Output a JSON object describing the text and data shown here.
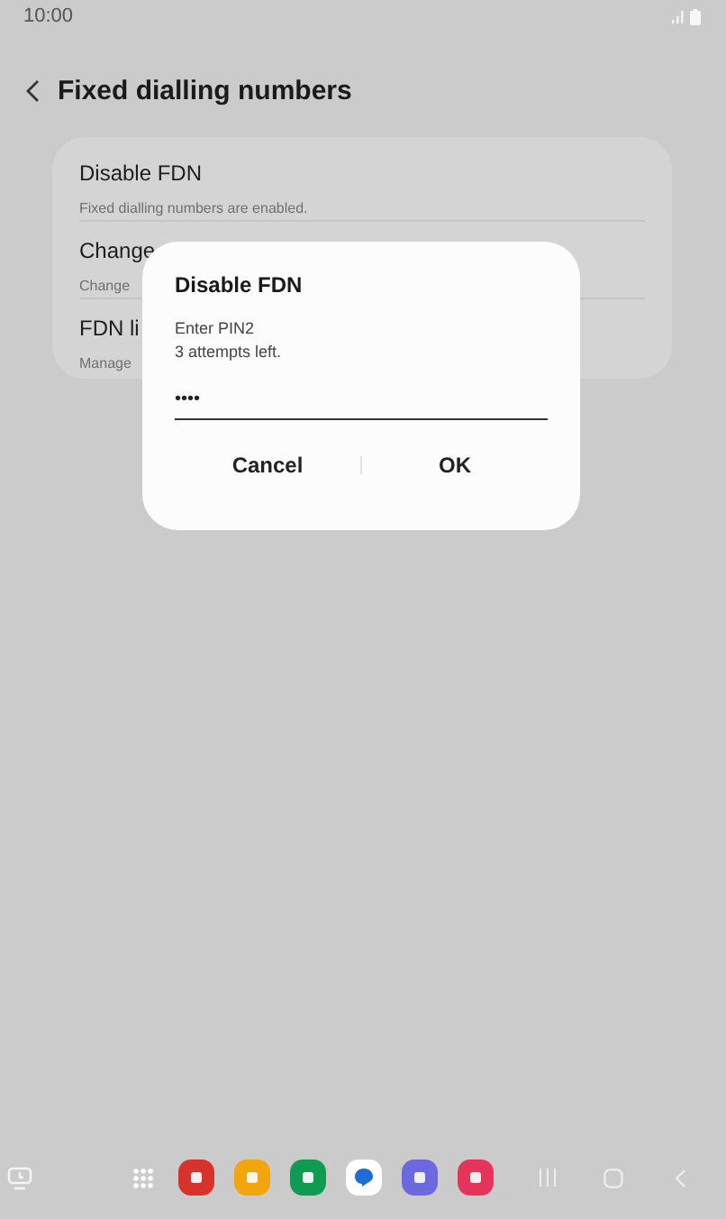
{
  "status_bar": {
    "time": "10:00"
  },
  "header": {
    "title": "Fixed dialling numbers"
  },
  "settings": [
    {
      "title": "Disable FDN",
      "subtitle": "Fixed dialling numbers are enabled."
    },
    {
      "title": "Change",
      "subtitle": "Change"
    },
    {
      "title": "FDN li",
      "subtitle": "Manage"
    }
  ],
  "dialog": {
    "title": "Disable FDN",
    "message": "Enter PIN2",
    "note": "3 attempts left.",
    "value": "••••",
    "buttons": [
      "Cancel",
      "OK"
    ]
  }
}
